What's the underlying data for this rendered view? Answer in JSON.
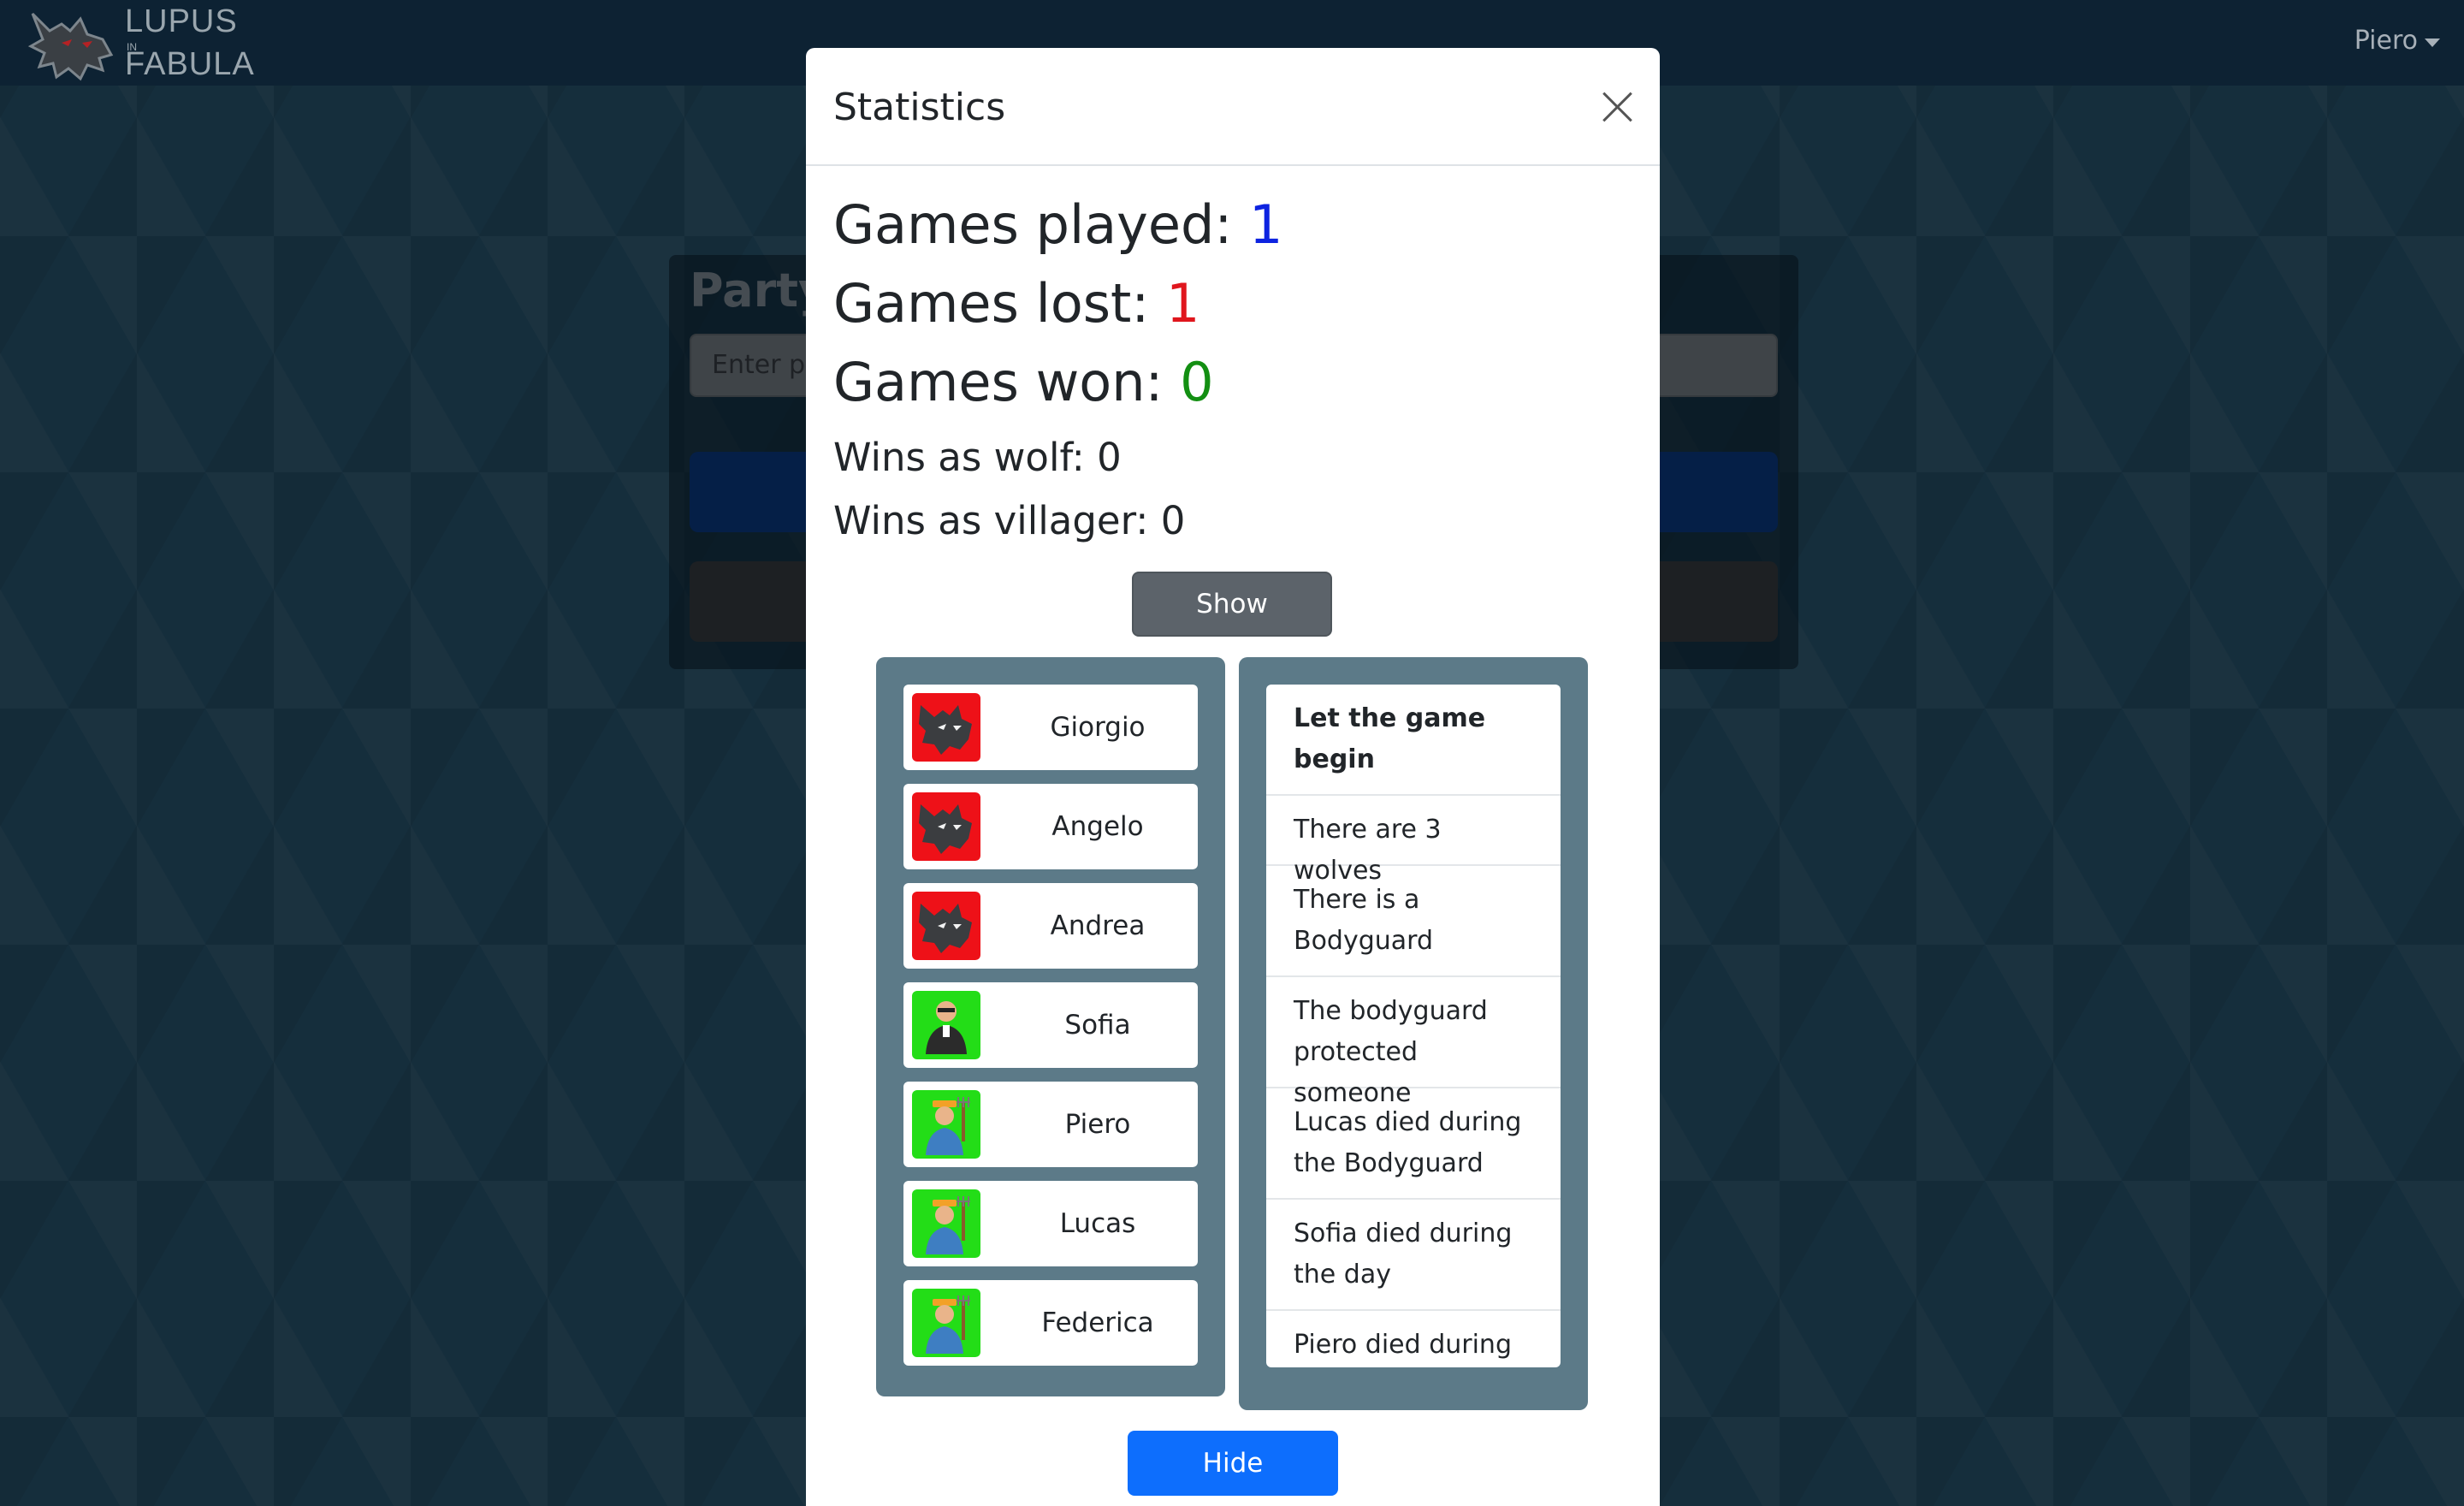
{
  "navbar": {
    "logo_top": "LUPUS",
    "logo_in": "IN",
    "logo_bottom": "FABULA",
    "user": "Piero"
  },
  "background_card": {
    "title": "Party:",
    "input_placeholder": "Enter pa"
  },
  "modal": {
    "title": "Statistics",
    "games_played_label": "Games played:",
    "games_played": "1",
    "games_lost_label": "Games lost:",
    "games_lost": "1",
    "games_won_label": "Games won:",
    "games_won": "0",
    "wins_wolf_label": "Wins as wolf:",
    "wins_wolf": "0",
    "wins_villager_label": "Wins as villager:",
    "wins_villager": "0",
    "show_label": "Show",
    "hide_label": "Hide"
  },
  "players": [
    {
      "name": "Giorgio",
      "role_icon": "wolf-icon"
    },
    {
      "name": "Angelo",
      "role_icon": "wolf-icon"
    },
    {
      "name": "Andrea",
      "role_icon": "wolf-icon"
    },
    {
      "name": "Sofia",
      "role_icon": "bodyguard-icon"
    },
    {
      "name": "Piero",
      "role_icon": "farmer-icon"
    },
    {
      "name": "Lucas",
      "role_icon": "farmer-icon"
    },
    {
      "name": "Federica",
      "role_icon": "farmer-icon"
    }
  ],
  "events": [
    "Let the game begin",
    "There are 3 wolves",
    "There is a Bodyguard",
    "The bodyguard protected someone",
    "Lucas died during the Bodyguard",
    "Sofia died during the day",
    "Piero died during"
  ],
  "colors": {
    "navbar": "#0d2233",
    "background": "#2b5c78",
    "played_value": "#0d23e0",
    "lost_value": "#e0161d",
    "won_value": "#138f12",
    "wolf_tile": "#ee1118",
    "villager_tile": "#23dd17",
    "primary_button": "#0d6efd",
    "secondary_button": "#5c636a",
    "panel": "#5c7a88"
  }
}
